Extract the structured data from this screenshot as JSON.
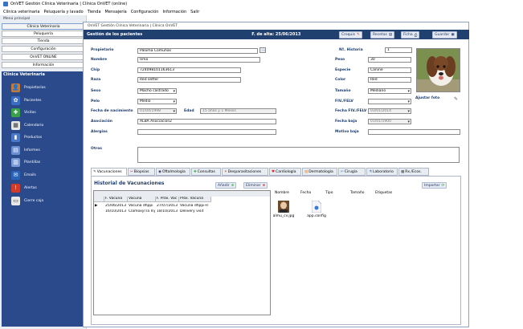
{
  "window": {
    "title": "OnVET Gestión Clínica Veterinaria | Clínica OnVET (online)"
  },
  "menubar": [
    "Clínica veterinaria",
    "Peluquería y lavado",
    "Tienda",
    "Mensajería",
    "Configuración",
    "Información",
    "Salir"
  ],
  "sidebar": {
    "menu_label": "Menú principal",
    "top_buttons": [
      "Clínica Veterinaria",
      "Peluquería",
      "Tienda",
      "Configuración",
      "OnVET ONLINE",
      "Información"
    ],
    "vet_header": "Clínica Veterinaria",
    "nav_items": [
      "Propietarios",
      "Pacientes",
      "Visitas",
      "Calendario",
      "Productos",
      "Informes",
      "Plantillas",
      "Emails",
      "Alertas",
      "Cierre caja"
    ]
  },
  "main": {
    "window_title": "OnVET Gestión Clínica Veterinaria | Clínica OnVET",
    "header_title": "Gestión de los pacientes",
    "alta_date": "F. de alta: 25/06/2013",
    "buttons": {
      "croquis": "Croquis",
      "recetas": "Recetas",
      "ficha": "Ficha",
      "guardar": "Guardar"
    }
  },
  "form": {
    "propietario": {
      "label": "Propietario",
      "value": "Paloma Comuñas"
    },
    "nombre": {
      "label": "Nombre",
      "value": "Urko"
    },
    "chip": {
      "label": "Chip",
      "value": "724098101163613"
    },
    "raza": {
      "label": "Raza",
      "value": "Red setter"
    },
    "sexo": {
      "label": "Sexo",
      "value": "Macho castrado"
    },
    "pelo": {
      "label": "Pelo",
      "value": "Medio"
    },
    "nacimiento": {
      "label": "Fecha de nacimiento",
      "value": "01/04/1998"
    },
    "edad": {
      "label": "Edad",
      "value": "15 años y 1 Meses"
    },
    "asociacion": {
      "label": "Asociación",
      "value": "ALBA Asociacion2"
    },
    "alergias": {
      "label": "Alergias",
      "value": ""
    },
    "historia": {
      "label": "Nº. Historia",
      "value": "1"
    },
    "peso": {
      "label": "Peso",
      "value": "30"
    },
    "especie": {
      "label": "Especie",
      "value": "Canine"
    },
    "color": {
      "label": "Color",
      "value": "Red"
    },
    "tamano": {
      "label": "Tamaño",
      "value": "Mediano"
    },
    "fiv": {
      "label": "FIV./FELV",
      "value": ""
    },
    "fecha_fiv": {
      "label": "Fecha FIV./FELV",
      "value": "03/01/2014"
    },
    "fecha_baja": {
      "label": "Fecha baja",
      "value": "01/01/1900"
    },
    "motivo_baja": {
      "label": "Motivo baja",
      "value": ""
    },
    "otros": {
      "label": "Otros",
      "value": ""
    },
    "ajustar_foto": "Ajustar foto",
    "picker": "..."
  },
  "tabs": [
    "Vacunaciones",
    "Biopsias",
    "Oftalmología",
    "Consultas",
    "Desparasitaciones",
    "Cardiología",
    "Dermatología",
    "Cirugía",
    "Laboratorio",
    "Rx./Ecos."
  ],
  "vacunas": {
    "title": "Historial de Vacunaciones",
    "add_label": "Añadir",
    "del_label": "Eliminar",
    "columns": [
      "F. Vacuna",
      "Vacuna",
      "F. Próx. Vac",
      "Próx. Vacuna"
    ],
    "rows": [
      {
        "marker": "▶",
        "fecha": "25/06/2013",
        "vacuna": "Vacuna dhppi",
        "prox_fecha": "27/07/2013",
        "prox": "Vacuna dhppi+l"
      },
      {
        "marker": "",
        "fecha": "16/10/2013",
        "vacuna": "Clamoxyl la Inj 100ml",
        "prox_fecha": "18/10/2013",
        "prox": "Delivery visit"
      }
    ]
  },
  "archivos": {
    "columns": [
      "Nombre",
      "Fecha",
      "Tipo",
      "Tamaño",
      "Etiquetas"
    ],
    "import_label": "Importar",
    "files": [
      "almu_cv.jpg",
      "app.config"
    ]
  },
  "colors": {
    "header": "#204070",
    "sidebar": "#2a4a8c",
    "label": "#1a3b6e"
  }
}
